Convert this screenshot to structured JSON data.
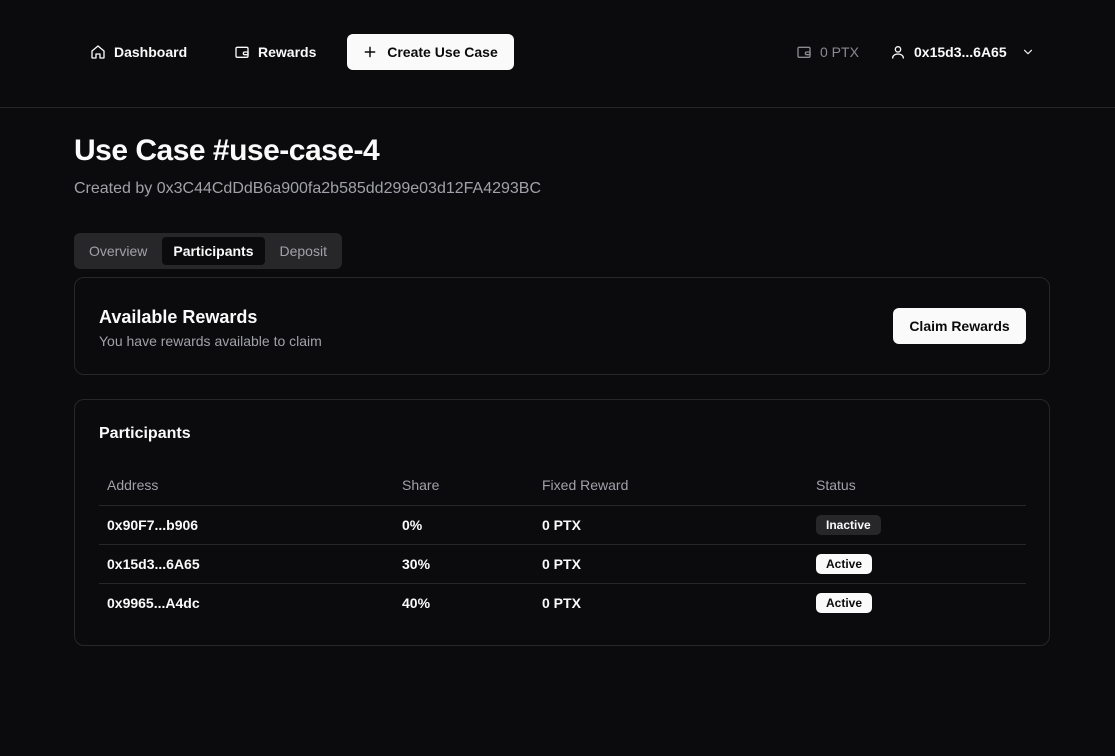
{
  "nav": {
    "dashboard_label": "Dashboard",
    "rewards_label": "Rewards",
    "create_label": "Create Use Case",
    "balance": "0 PTX",
    "account": "0x15d3...6A65"
  },
  "page": {
    "title": "Use Case #use-case-4",
    "subtitle": "Created by 0x3C44CdDdB6a900fa2b585dd299e03d12FA4293BC"
  },
  "tabs": [
    {
      "label": "Overview",
      "active": false
    },
    {
      "label": "Participants",
      "active": true
    },
    {
      "label": "Deposit",
      "active": false
    }
  ],
  "rewards": {
    "title": "Available Rewards",
    "description": "You have rewards available to claim",
    "claim_label": "Claim Rewards"
  },
  "participants": {
    "title": "Participants",
    "headers": [
      "Address",
      "Share",
      "Fixed Reward",
      "Status"
    ],
    "rows": [
      {
        "address": "0x90F7...b906",
        "share": "0%",
        "fixed_reward": "0 PTX",
        "status": "Inactive"
      },
      {
        "address": "0x15d3...6A65",
        "share": "30%",
        "fixed_reward": "0 PTX",
        "status": "Active"
      },
      {
        "address": "0x9965...A4dc",
        "share": "40%",
        "fixed_reward": "0 PTX",
        "status": "Active"
      }
    ]
  },
  "colors": {
    "background": "#0b0b0d",
    "border": "#27272a",
    "muted_text": "#a1a1aa",
    "primary": "#fafafa"
  },
  "icons": {
    "dashboard": "home-icon",
    "rewards": "wallet-icon",
    "create": "plus-icon",
    "balance": "wallet-icon",
    "account": "user-icon",
    "account_menu": "chevron-down-icon"
  }
}
